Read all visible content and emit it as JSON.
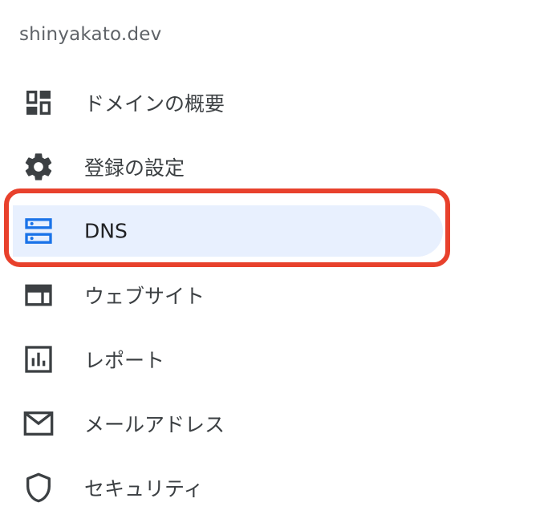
{
  "domain": "shinyakato.dev",
  "nav": {
    "items": [
      {
        "label": "ドメインの概要",
        "icon": "dashboard-icon"
      },
      {
        "label": "登録の設定",
        "icon": "gear-icon"
      },
      {
        "label": "DNS",
        "icon": "dns-icon",
        "active": true
      },
      {
        "label": "ウェブサイト",
        "icon": "website-icon"
      },
      {
        "label": "レポート",
        "icon": "report-icon"
      },
      {
        "label": "メールアドレス",
        "icon": "mail-icon"
      },
      {
        "label": "セキュリティ",
        "icon": "shield-icon"
      }
    ]
  },
  "colors": {
    "active_background": "#e8f0fe",
    "active_icon": "#1a73e8",
    "icon": "#3c4043",
    "highlight_border": "#e8412c"
  }
}
